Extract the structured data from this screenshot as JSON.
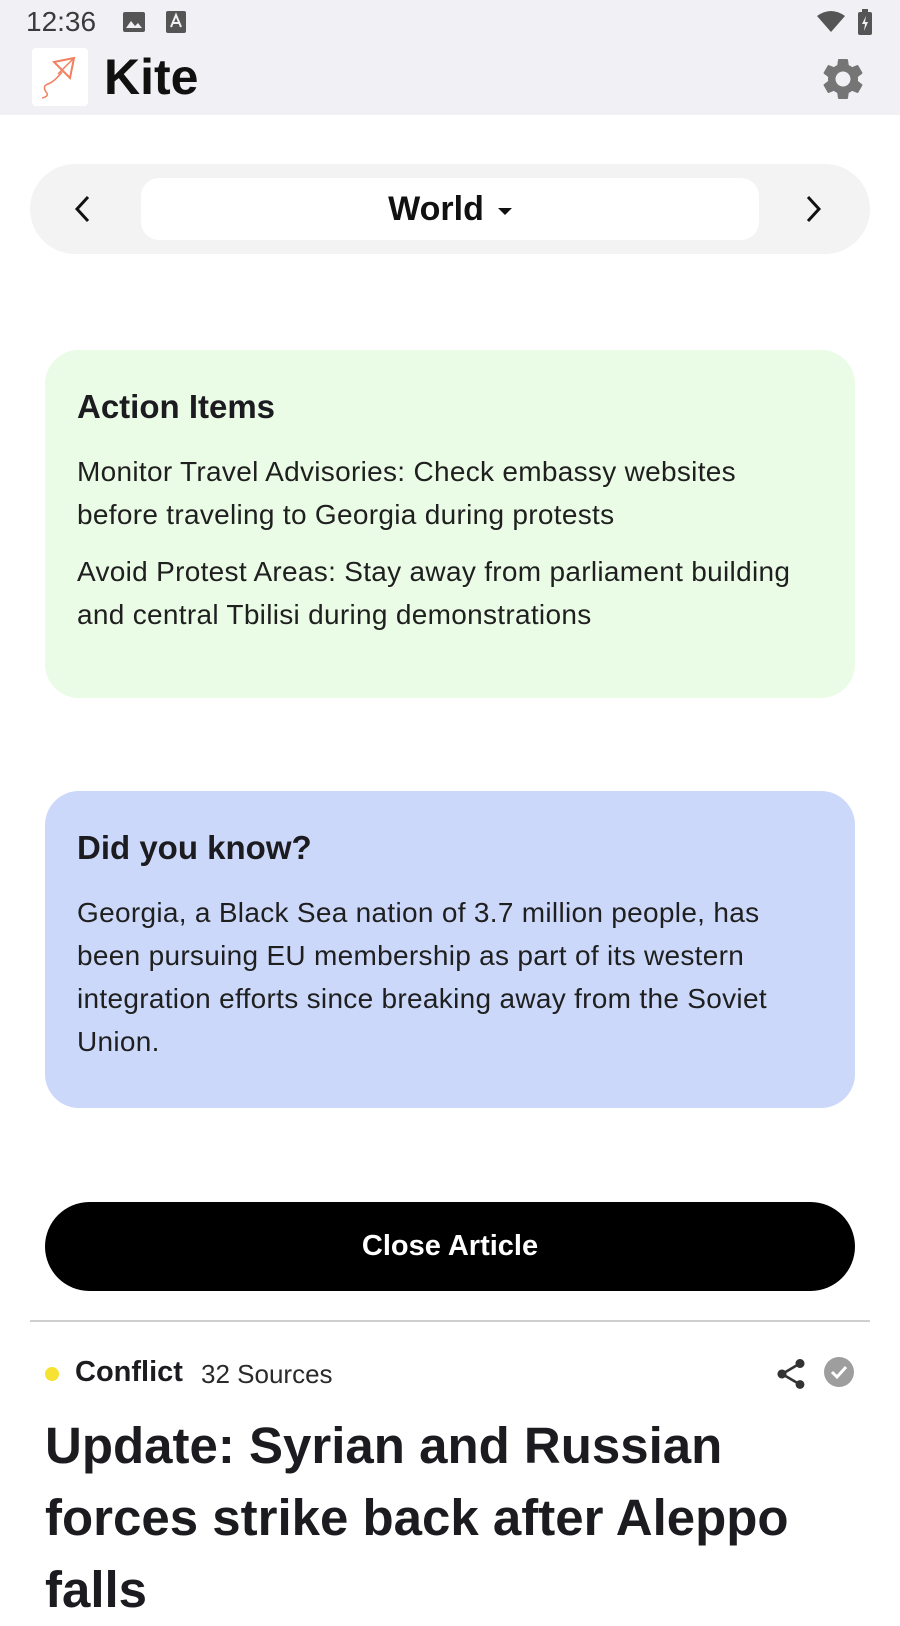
{
  "status_bar": {
    "time": "12:36"
  },
  "app": {
    "title": "Kite"
  },
  "category_selector": {
    "selected": "World"
  },
  "action_items": {
    "title": "Action Items",
    "items": [
      "Monitor Travel Advisories: Check embassy websites before traveling to Georgia during protests",
      "Avoid Protest Areas: Stay away from parliament building and central Tbilisi during demonstrations"
    ]
  },
  "did_you_know": {
    "title": "Did you know?",
    "text": "Georgia, a Black Sea nation of 3.7 million people, has been pursuing EU membership as part of its western integration efforts since breaking away from the Soviet Union."
  },
  "close_button": {
    "label": "Close Article"
  },
  "next_article": {
    "category": "Conflict",
    "category_color": "#f6e232",
    "sources": "32 Sources",
    "headline": "Update: Syrian and Russian forces strike back after Aleppo falls"
  },
  "icons": {
    "status": [
      "image-icon",
      "keyboard-a-icon",
      "wifi-icon",
      "battery-charging-icon"
    ],
    "app_bar": [
      "kite-logo-icon",
      "gear-icon"
    ],
    "selector": [
      "chevron-left-icon",
      "caret-down-icon",
      "chevron-right-icon"
    ],
    "article": [
      "share-icon",
      "check-circle-icon"
    ]
  },
  "colors": {
    "app_bar_bg": "#f1f0f5",
    "action_card_bg": "#eafbe6",
    "did_you_know_bg": "#cbd8fa",
    "close_button_bg": "#000000"
  }
}
